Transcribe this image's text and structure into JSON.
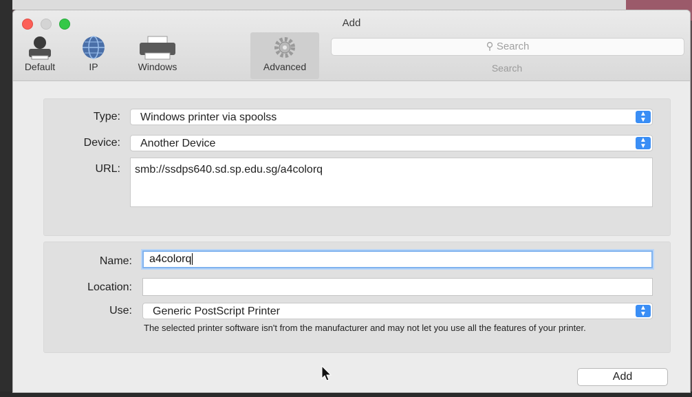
{
  "window": {
    "title": "Add"
  },
  "toolbar": {
    "items": [
      {
        "label": "Default",
        "icon": "default-printer-icon"
      },
      {
        "label": "IP",
        "icon": "globe-icon"
      },
      {
        "label": "Windows",
        "icon": "windows-printer-icon"
      },
      {
        "label": "Advanced",
        "icon": "gear-icon",
        "selected": true
      }
    ],
    "search": {
      "placeholder": "Search",
      "label": "Search"
    }
  },
  "advanced": {
    "type_label": "Type:",
    "type_value": "Windows printer via spoolss",
    "device_label": "Device:",
    "device_value": "Another Device",
    "url_label": "URL:",
    "url_value": "smb://ssdps640.sd.sp.edu.sg/a4colorq"
  },
  "details": {
    "name_label": "Name:",
    "name_value": "a4colorq",
    "location_label": "Location:",
    "location_value": "",
    "use_label": "Use:",
    "use_value": "Generic PostScript Printer",
    "note": "The selected printer software isn't from the manufacturer and may not let you use all the features of your printer."
  },
  "buttons": {
    "add": "Add"
  },
  "colors": {
    "accent": "#3a8ef5",
    "close": "#fc5f57",
    "maximize": "#34c848",
    "focus_ring": "#7fb2ef"
  }
}
